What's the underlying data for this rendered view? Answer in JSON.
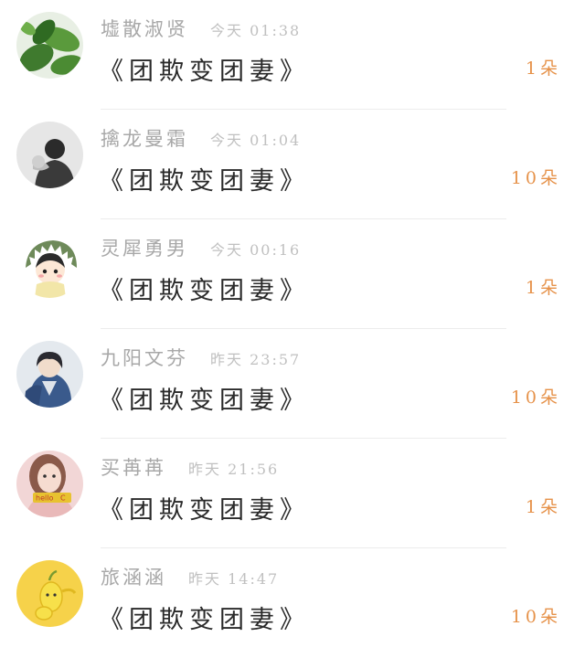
{
  "messages": [
    {
      "name": "墟散淑贤",
      "time": "今天 01:38",
      "text": "《团欺变团妻》",
      "count": "1朵",
      "avatar_icon": "plant-leaves-avatar"
    },
    {
      "name": "擒龙曼霜",
      "time": "今天 01:04",
      "text": "《团欺变团妻》",
      "count": "10朵",
      "avatar_icon": "monochrome-person-avatar"
    },
    {
      "name": "灵犀勇男",
      "time": "今天 00:16",
      "text": "《团欺变团妻》",
      "count": "1朵",
      "avatar_icon": "cartoon-dinosaur-girl-avatar"
    },
    {
      "name": "九阳文芬",
      "time": "昨天 23:57",
      "text": "《团欺变团妻》",
      "count": "10朵",
      "avatar_icon": "anime-boy-blue-hoodie-avatar"
    },
    {
      "name": "买苒苒",
      "time": "昨天 21:56",
      "text": "《团欺变团妻》",
      "count": "1朵",
      "avatar_icon": "girl-photo-hello-sticker-avatar"
    },
    {
      "name": "旅涵涵",
      "time": "昨天 14:47",
      "text": "《团欺变团妻》",
      "count": "10朵",
      "avatar_icon": "yellow-character-avatar"
    }
  ],
  "colors": {
    "name": "#a8a8a8",
    "time": "#c0c0c0",
    "message": "#2a2a2a",
    "count": "#e6924a",
    "divider": "#ececec"
  }
}
